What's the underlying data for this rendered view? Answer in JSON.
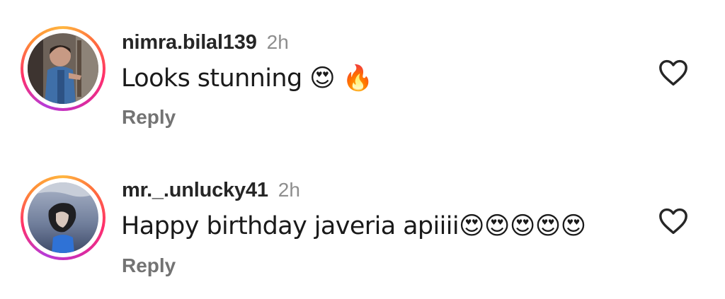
{
  "comments": [
    {
      "username": "nimra.bilal139",
      "timestamp": "2h",
      "text": "Looks stunning 😍 🔥",
      "reply_label": "Reply",
      "like_icon": "heart-outline-icon",
      "avatar_icon": "profile-photo"
    },
    {
      "username": "mr._.unlucky41",
      "timestamp": "2h",
      "text": "Happy birthday javeria apiiii😍😍😍😍😍",
      "reply_label": "Reply",
      "like_icon": "heart-outline-icon",
      "avatar_icon": "profile-photo"
    }
  ],
  "colors": {
    "text": "#262626",
    "muted": "#8e8e8e",
    "reply": "#737373",
    "story_ring": [
      "#ffb640",
      "#ff2f6d",
      "#b63bd8"
    ]
  }
}
